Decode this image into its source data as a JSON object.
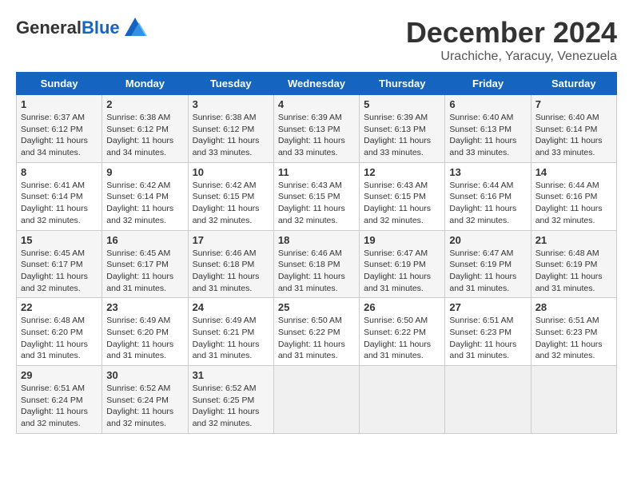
{
  "logo": {
    "general": "General",
    "blue": "Blue"
  },
  "title": "December 2024",
  "subtitle": "Urachiche, Yaracuy, Venezuela",
  "days_header": [
    "Sunday",
    "Monday",
    "Tuesday",
    "Wednesday",
    "Thursday",
    "Friday",
    "Saturday"
  ],
  "weeks": [
    [
      {
        "num": "1",
        "sunrise": "6:37 AM",
        "sunset": "6:12 PM",
        "daylight": "11 hours and 34 minutes."
      },
      {
        "num": "2",
        "sunrise": "6:38 AM",
        "sunset": "6:12 PM",
        "daylight": "11 hours and 34 minutes."
      },
      {
        "num": "3",
        "sunrise": "6:38 AM",
        "sunset": "6:12 PM",
        "daylight": "11 hours and 33 minutes."
      },
      {
        "num": "4",
        "sunrise": "6:39 AM",
        "sunset": "6:13 PM",
        "daylight": "11 hours and 33 minutes."
      },
      {
        "num": "5",
        "sunrise": "6:39 AM",
        "sunset": "6:13 PM",
        "daylight": "11 hours and 33 minutes."
      },
      {
        "num": "6",
        "sunrise": "6:40 AM",
        "sunset": "6:13 PM",
        "daylight": "11 hours and 33 minutes."
      },
      {
        "num": "7",
        "sunrise": "6:40 AM",
        "sunset": "6:14 PM",
        "daylight": "11 hours and 33 minutes."
      }
    ],
    [
      {
        "num": "8",
        "sunrise": "6:41 AM",
        "sunset": "6:14 PM",
        "daylight": "11 hours and 32 minutes."
      },
      {
        "num": "9",
        "sunrise": "6:42 AM",
        "sunset": "6:14 PM",
        "daylight": "11 hours and 32 minutes."
      },
      {
        "num": "10",
        "sunrise": "6:42 AM",
        "sunset": "6:15 PM",
        "daylight": "11 hours and 32 minutes."
      },
      {
        "num": "11",
        "sunrise": "6:43 AM",
        "sunset": "6:15 PM",
        "daylight": "11 hours and 32 minutes."
      },
      {
        "num": "12",
        "sunrise": "6:43 AM",
        "sunset": "6:15 PM",
        "daylight": "11 hours and 32 minutes."
      },
      {
        "num": "13",
        "sunrise": "6:44 AM",
        "sunset": "6:16 PM",
        "daylight": "11 hours and 32 minutes."
      },
      {
        "num": "14",
        "sunrise": "6:44 AM",
        "sunset": "6:16 PM",
        "daylight": "11 hours and 32 minutes."
      }
    ],
    [
      {
        "num": "15",
        "sunrise": "6:45 AM",
        "sunset": "6:17 PM",
        "daylight": "11 hours and 32 minutes."
      },
      {
        "num": "16",
        "sunrise": "6:45 AM",
        "sunset": "6:17 PM",
        "daylight": "11 hours and 31 minutes."
      },
      {
        "num": "17",
        "sunrise": "6:46 AM",
        "sunset": "6:18 PM",
        "daylight": "11 hours and 31 minutes."
      },
      {
        "num": "18",
        "sunrise": "6:46 AM",
        "sunset": "6:18 PM",
        "daylight": "11 hours and 31 minutes."
      },
      {
        "num": "19",
        "sunrise": "6:47 AM",
        "sunset": "6:19 PM",
        "daylight": "11 hours and 31 minutes."
      },
      {
        "num": "20",
        "sunrise": "6:47 AM",
        "sunset": "6:19 PM",
        "daylight": "11 hours and 31 minutes."
      },
      {
        "num": "21",
        "sunrise": "6:48 AM",
        "sunset": "6:19 PM",
        "daylight": "11 hours and 31 minutes."
      }
    ],
    [
      {
        "num": "22",
        "sunrise": "6:48 AM",
        "sunset": "6:20 PM",
        "daylight": "11 hours and 31 minutes."
      },
      {
        "num": "23",
        "sunrise": "6:49 AM",
        "sunset": "6:20 PM",
        "daylight": "11 hours and 31 minutes."
      },
      {
        "num": "24",
        "sunrise": "6:49 AM",
        "sunset": "6:21 PM",
        "daylight": "11 hours and 31 minutes."
      },
      {
        "num": "25",
        "sunrise": "6:50 AM",
        "sunset": "6:22 PM",
        "daylight": "11 hours and 31 minutes."
      },
      {
        "num": "26",
        "sunrise": "6:50 AM",
        "sunset": "6:22 PM",
        "daylight": "11 hours and 31 minutes."
      },
      {
        "num": "27",
        "sunrise": "6:51 AM",
        "sunset": "6:23 PM",
        "daylight": "11 hours and 31 minutes."
      },
      {
        "num": "28",
        "sunrise": "6:51 AM",
        "sunset": "6:23 PM",
        "daylight": "11 hours and 32 minutes."
      }
    ],
    [
      {
        "num": "29",
        "sunrise": "6:51 AM",
        "sunset": "6:24 PM",
        "daylight": "11 hours and 32 minutes."
      },
      {
        "num": "30",
        "sunrise": "6:52 AM",
        "sunset": "6:24 PM",
        "daylight": "11 hours and 32 minutes."
      },
      {
        "num": "31",
        "sunrise": "6:52 AM",
        "sunset": "6:25 PM",
        "daylight": "11 hours and 32 minutes."
      },
      null,
      null,
      null,
      null
    ]
  ],
  "labels": {
    "sunrise": "Sunrise: ",
    "sunset": "Sunset: ",
    "daylight": "Daylight: "
  }
}
